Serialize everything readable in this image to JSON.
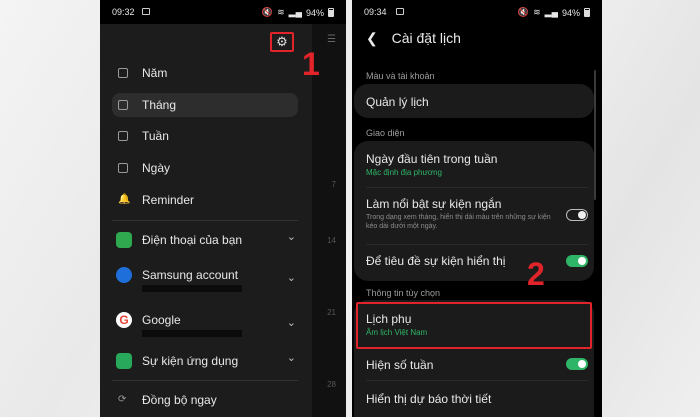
{
  "left_phone": {
    "status": {
      "time": "09:32",
      "battery": "94%"
    },
    "menu": [
      {
        "label": "Năm",
        "icon": "calendar-icon"
      },
      {
        "label": "Tháng",
        "icon": "calendar-month-icon",
        "selected": true
      },
      {
        "label": "Tuần",
        "icon": "calendar-week-icon"
      },
      {
        "label": "Ngày",
        "icon": "calendar-day-icon"
      },
      {
        "label": "Reminder",
        "icon": "bell-icon"
      }
    ],
    "accounts": [
      {
        "label": "Điện thoại của bạn",
        "icon": "phone-icon",
        "color": "#2fa84f"
      },
      {
        "label": "Samsung account",
        "icon": "samsung-account-icon",
        "color": "#1e6fd9"
      },
      {
        "label": "Google",
        "icon": "google-icon",
        "color": "#ffffff"
      },
      {
        "label": "Sự kiện ứng dụng",
        "icon": "app-events-icon",
        "color": "#27a85a"
      }
    ],
    "sync_label": "Đồng bộ ngay",
    "strip_numbers": [
      "7",
      "14",
      "21",
      "28"
    ],
    "step_marker": "1"
  },
  "right_phone": {
    "status": {
      "time": "09:34",
      "battery": "94%"
    },
    "title": "Cài đặt lịch",
    "sections": {
      "account": "Màu và tài khoản",
      "interface": "Giao diện",
      "options": "Thông tin tùy chọn"
    },
    "rows": {
      "manage": "Quản lý lịch",
      "first_day": "Ngày đầu tiên trong tuần",
      "first_day_value": "Mặc định địa phương",
      "highlight": "Làm nổi bật sự kiện ngắn",
      "highlight_desc": "Trong dạng xem tháng, hiển thị dải màu trên những sự kiện kéo dài dưới một ngày.",
      "titles": "Để tiêu đề sự kiện hiển thị",
      "alt_cal": "Lịch phụ",
      "alt_cal_value": "Âm lịch Việt Nam",
      "week_num": "Hiện số tuần",
      "weather": "Hiển thị dự báo thời tiết"
    },
    "toggles": {
      "highlight": false,
      "titles": true,
      "week_num": true
    },
    "step_marker": "2"
  },
  "colors": {
    "accent_green": "#2fb568",
    "highlight_red": "#e0242a"
  }
}
